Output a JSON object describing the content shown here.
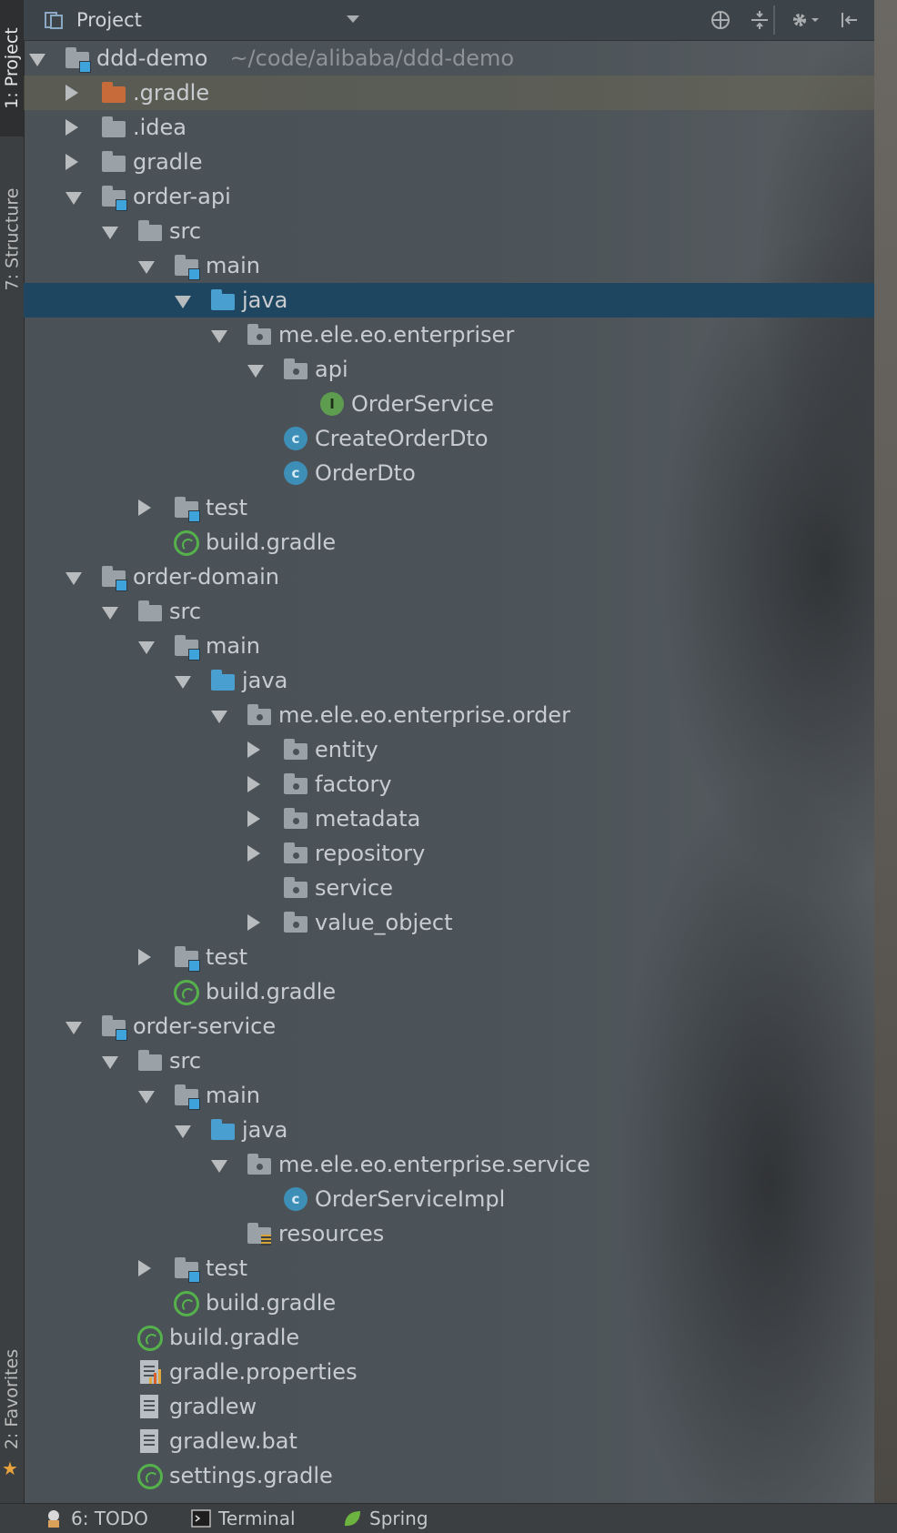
{
  "header": {
    "title": "Project"
  },
  "side_tabs": {
    "project": "1: Project",
    "structure": "7: Structure",
    "favorites": "2: Favorites"
  },
  "tree": [
    {
      "label": "ddd-demo",
      "path": "~/code/alibaba/ddd-demo",
      "level": 0,
      "arrow": "down",
      "icon": "module-folder"
    },
    {
      "label": ".gradle",
      "level": 1,
      "arrow": "right",
      "icon": "orange-folder",
      "highlight": "yellow"
    },
    {
      "label": ".idea",
      "level": 1,
      "arrow": "right",
      "icon": "folder"
    },
    {
      "label": "gradle",
      "level": 1,
      "arrow": "right",
      "icon": "folder"
    },
    {
      "label": "order-api",
      "level": 1,
      "arrow": "down",
      "icon": "module-folder"
    },
    {
      "label": "src",
      "level": 2,
      "arrow": "down",
      "icon": "folder"
    },
    {
      "label": "main",
      "level": 3,
      "arrow": "down",
      "icon": "module-folder"
    },
    {
      "label": "java",
      "level": 4,
      "arrow": "down",
      "icon": "source-folder",
      "selected": true
    },
    {
      "label": "me.ele.eo.enterpriser",
      "level": 5,
      "arrow": "down",
      "icon": "package"
    },
    {
      "label": "api",
      "level": 6,
      "arrow": "down",
      "icon": "package"
    },
    {
      "label": "OrderService",
      "level": 7,
      "arrow": "",
      "icon": "interface"
    },
    {
      "label": "CreateOrderDto",
      "level": 6,
      "arrow": "",
      "icon": "class"
    },
    {
      "label": "OrderDto",
      "level": 6,
      "arrow": "",
      "icon": "class"
    },
    {
      "label": "test",
      "level": 3,
      "arrow": "right",
      "icon": "module-folder"
    },
    {
      "label": "build.gradle",
      "level": 3,
      "arrow": "",
      "icon": "gradle"
    },
    {
      "label": "order-domain",
      "level": 1,
      "arrow": "down",
      "icon": "module-folder"
    },
    {
      "label": "src",
      "level": 2,
      "arrow": "down",
      "icon": "folder"
    },
    {
      "label": "main",
      "level": 3,
      "arrow": "down",
      "icon": "module-folder"
    },
    {
      "label": "java",
      "level": 4,
      "arrow": "down",
      "icon": "source-folder"
    },
    {
      "label": "me.ele.eo.enterprise.order",
      "level": 5,
      "arrow": "down",
      "icon": "package"
    },
    {
      "label": "entity",
      "level": 6,
      "arrow": "right",
      "icon": "package"
    },
    {
      "label": "factory",
      "level": 6,
      "arrow": "right",
      "icon": "package"
    },
    {
      "label": "metadata",
      "level": 6,
      "arrow": "right",
      "icon": "package"
    },
    {
      "label": "repository",
      "level": 6,
      "arrow": "right",
      "icon": "package"
    },
    {
      "label": "service",
      "level": 6,
      "arrow": "",
      "icon": "package"
    },
    {
      "label": "value_object",
      "level": 6,
      "arrow": "right",
      "icon": "package"
    },
    {
      "label": "test",
      "level": 3,
      "arrow": "right",
      "icon": "module-folder"
    },
    {
      "label": "build.gradle",
      "level": 3,
      "arrow": "",
      "icon": "gradle"
    },
    {
      "label": "order-service",
      "level": 1,
      "arrow": "down",
      "icon": "module-folder"
    },
    {
      "label": "src",
      "level": 2,
      "arrow": "down",
      "icon": "folder"
    },
    {
      "label": "main",
      "level": 3,
      "arrow": "down",
      "icon": "module-folder"
    },
    {
      "label": "java",
      "level": 4,
      "arrow": "down",
      "icon": "source-folder"
    },
    {
      "label": "me.ele.eo.enterprise.service",
      "level": 5,
      "arrow": "down",
      "icon": "package"
    },
    {
      "label": "OrderServiceImpl",
      "level": 6,
      "arrow": "",
      "icon": "class"
    },
    {
      "label": "resources",
      "level": 5,
      "arrow": "",
      "icon": "resources-folder"
    },
    {
      "label": "test",
      "level": 3,
      "arrow": "right",
      "icon": "module-folder"
    },
    {
      "label": "build.gradle",
      "level": 3,
      "arrow": "",
      "icon": "gradle"
    },
    {
      "label": "build.gradle",
      "level": 2,
      "arrow": "",
      "icon": "gradle"
    },
    {
      "label": "gradle.properties",
      "level": 2,
      "arrow": "",
      "icon": "properties-file"
    },
    {
      "label": "gradlew",
      "level": 2,
      "arrow": "",
      "icon": "text-file"
    },
    {
      "label": "gradlew.bat",
      "level": 2,
      "arrow": "",
      "icon": "text-file"
    },
    {
      "label": "settings.gradle",
      "level": 2,
      "arrow": "",
      "icon": "gradle"
    }
  ],
  "bottom_tabs": [
    {
      "label": "6: TODO",
      "icon": "todo-icon"
    },
    {
      "label": "Terminal",
      "icon": "terminal-icon"
    },
    {
      "label": "Spring",
      "icon": "spring-icon"
    }
  ],
  "colors": {
    "selection": "#1f4660",
    "class_icon": "#3d8fb8",
    "interface_icon": "#5e9c4f",
    "gradle_icon": "#55b24b",
    "module_marker": "#3fa3db"
  }
}
